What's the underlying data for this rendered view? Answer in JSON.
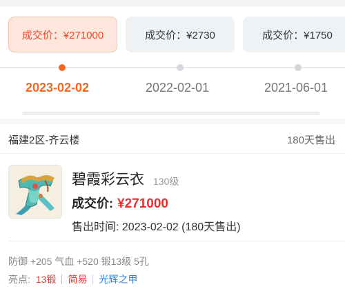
{
  "timeline": {
    "cards": [
      {
        "label": "成交价：¥271000",
        "date": "2023-02-02",
        "active": true
      },
      {
        "label": "成交价：¥2730",
        "date": "2022-02-01",
        "active": false
      },
      {
        "label": "成交价：¥1750",
        "date": "2021-06-01",
        "active": false
      }
    ]
  },
  "listing": {
    "server": "福建2区-齐云楼",
    "sold_days": "180天售出",
    "item_icon": "colorful-robe-icon",
    "item_name": "碧霞彩云衣",
    "item_level": "130级",
    "price_label": "成交价:",
    "price_value": "¥271000",
    "sold_time": "售出时间: 2023-02-02 (180天售出)",
    "stats": "防御 +205 气血 +520 锻13级 5孔",
    "highlights_label": "亮点:",
    "highlights": [
      "13锻",
      "简易",
      "光辉之甲"
    ]
  },
  "colors": {
    "accent_orange": "#f26b1d",
    "price_red": "#ee2e2e",
    "tag_blue": "#2f7fd8"
  }
}
